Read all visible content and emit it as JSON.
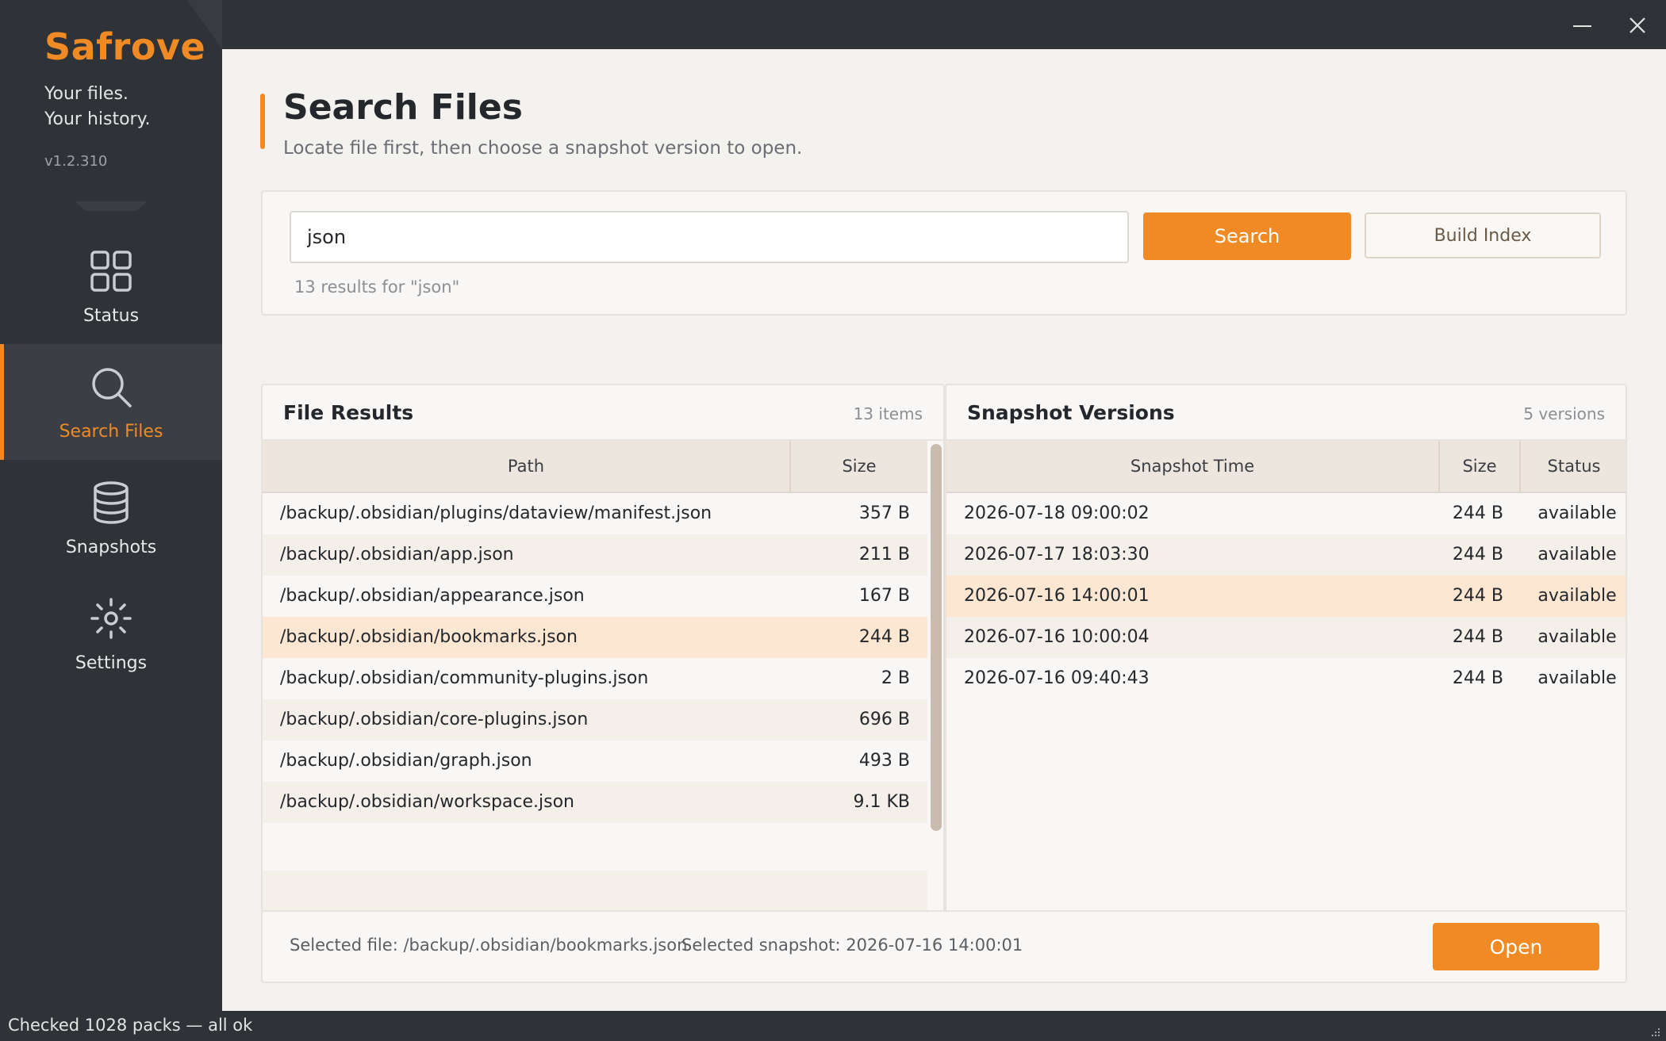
{
  "app": {
    "name": "Safrove",
    "tagline_1": "Your files.",
    "tagline_2": "Your history.",
    "version": "v1.2.310"
  },
  "nav": [
    {
      "label": "Status",
      "icon": "grid-icon"
    },
    {
      "label": "Search Files",
      "icon": "search-icon",
      "active": true
    },
    {
      "label": "Snapshots",
      "icon": "database-icon"
    },
    {
      "label": "Settings",
      "icon": "gear-icon"
    }
  ],
  "window": {
    "minimize_icon": "minimize-icon",
    "close_icon": "close-icon"
  },
  "page": {
    "title": "Search Files",
    "subtitle": "Locate file first, then choose a snapshot version to open."
  },
  "search": {
    "query": "json",
    "search_label": "Search",
    "build_label": "Build Index",
    "result_summary": "13 results for \"json\""
  },
  "files": {
    "title": "File Results",
    "count": "13 items",
    "columns": [
      "Path",
      "Size"
    ],
    "rows": [
      {
        "path": "/backup/.obsidian/plugins/dataview/manifest.json",
        "size": "357 B"
      },
      {
        "path": "/backup/.obsidian/app.json",
        "size": "211 B"
      },
      {
        "path": "/backup/.obsidian/appearance.json",
        "size": "167 B"
      },
      {
        "path": "/backup/.obsidian/bookmarks.json",
        "size": "244 B",
        "selected": true
      },
      {
        "path": "/backup/.obsidian/community-plugins.json",
        "size": "2 B"
      },
      {
        "path": "/backup/.obsidian/core-plugins.json",
        "size": "696 B"
      },
      {
        "path": "/backup/.obsidian/graph.json",
        "size": "493 B"
      },
      {
        "path": "/backup/.obsidian/workspace.json",
        "size": "9.1 KB"
      }
    ]
  },
  "snapshots": {
    "title": "Snapshot Versions",
    "count": "5 versions",
    "columns": [
      "Snapshot Time",
      "Size",
      "Status"
    ],
    "rows": [
      {
        "time": "2026-07-18 09:00:02",
        "size": "244 B",
        "status": "available"
      },
      {
        "time": "2026-07-17 18:03:30",
        "size": "244 B",
        "status": "available"
      },
      {
        "time": "2026-07-16 14:00:01",
        "size": "244 B",
        "status": "available",
        "selected": true
      },
      {
        "time": "2026-07-16 10:00:04",
        "size": "244 B",
        "status": "available"
      },
      {
        "time": "2026-07-16 09:40:43",
        "size": "244 B",
        "status": "available"
      }
    ]
  },
  "selection": {
    "file_text": "Selected file: /backup/.obsidian/bookmarks.json",
    "snapshot_text": "Selected snapshot: 2026-07-16 14:00:01",
    "open_label": "Open"
  },
  "statusbar": {
    "text": "Checked 1028 packs — all ok"
  },
  "colors": {
    "accent": "#f08a24",
    "sidebar_bg": "#2f3237",
    "selected_row": "#fde7d2"
  }
}
